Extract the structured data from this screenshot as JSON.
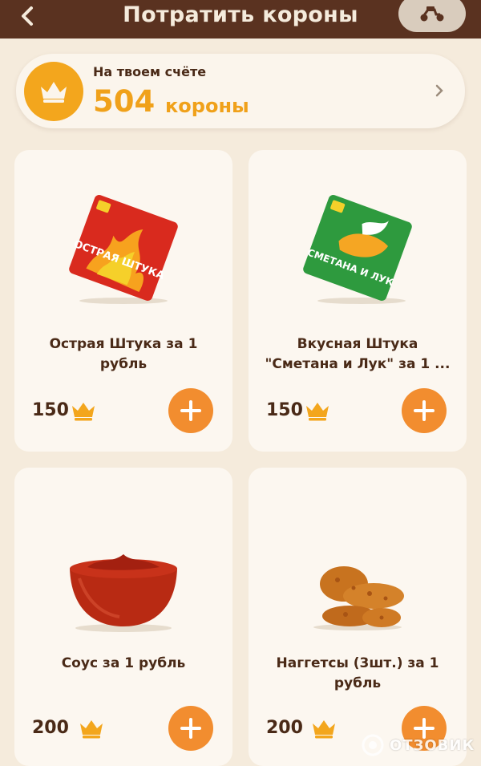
{
  "header": {
    "title": "Потратить короны"
  },
  "balance": {
    "label": "На твоем счёте",
    "amount": "504",
    "unit": "короны"
  },
  "products": [
    {
      "name_line1": "Острая Штука за 1",
      "name_line2": "рубль",
      "price": "150",
      "pack_text": "ОСТРАЯ ШТУКА"
    },
    {
      "name_line1": "Вкусная Штука",
      "name_line2": "\"Сметана и Лук\" за 1 ...",
      "price": "150",
      "pack_text": "СМЕТАНА И ЛУК"
    },
    {
      "name_line1": "Соус за 1 рубль",
      "name_line2": "",
      "price": "200"
    },
    {
      "name_line1": "Наггетсы (3шт.) за 1",
      "name_line2": "рубль",
      "price": "200"
    }
  ],
  "watermark": {
    "text": "ОТЗОВИК"
  },
  "colors": {
    "header": "#5a3220",
    "background": "#f5ebdc",
    "accent": "#f28d2f",
    "crown": "#f3a61d"
  }
}
